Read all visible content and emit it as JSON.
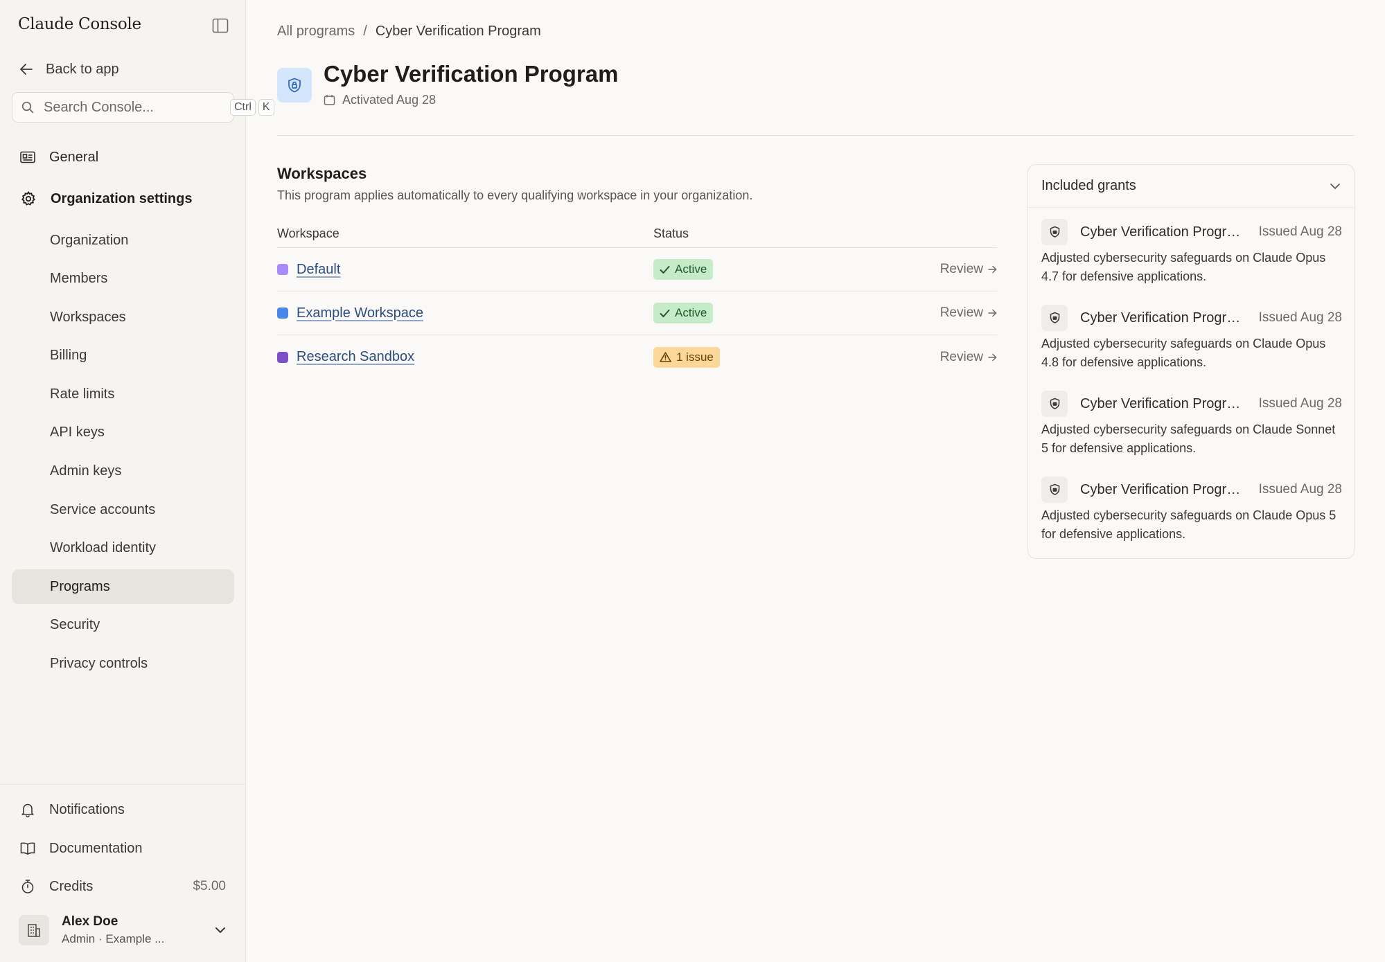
{
  "sidebar": {
    "brand": "Claude Console",
    "back_label": "Back to app",
    "search_placeholder": "Search Console...",
    "search_kbd_ctrl": "Ctrl",
    "search_kbd_key": "K",
    "general_label": "General",
    "org_settings_label": "Organization settings",
    "items": [
      {
        "label": "Organization"
      },
      {
        "label": "Members"
      },
      {
        "label": "Workspaces"
      },
      {
        "label": "Billing"
      },
      {
        "label": "Rate limits"
      },
      {
        "label": "API keys"
      },
      {
        "label": "Admin keys"
      },
      {
        "label": "Service accounts"
      },
      {
        "label": "Workload identity"
      },
      {
        "label": "Programs",
        "active": true
      },
      {
        "label": "Security"
      },
      {
        "label": "Privacy controls"
      }
    ],
    "notifications_label": "Notifications",
    "documentation_label": "Documentation",
    "credits_label": "Credits",
    "credits_amount": "$5.00",
    "user": {
      "name": "Alex Doe",
      "role": "Admin",
      "org": "Example ..."
    }
  },
  "main": {
    "breadcrumb_root": "All programs",
    "breadcrumb_sep": "/",
    "breadcrumb_current": "Cyber Verification Program",
    "title": "Cyber Verification Program",
    "activated": "Activated Aug 28",
    "workspaces": {
      "title": "Workspaces",
      "description": "This program applies automatically to every qualifying workspace in your organization.",
      "col_workspace": "Workspace",
      "col_status": "Status",
      "rows": [
        {
          "name": "Default",
          "color": "#a78bfa",
          "status": "Active",
          "status_type": "active",
          "action": "Review"
        },
        {
          "name": "Example Workspace",
          "color": "#4a86e8",
          "status": "Active",
          "status_type": "active",
          "action": "Review"
        },
        {
          "name": "Research Sandbox",
          "color": "#7e4fc9",
          "status": "1 issue",
          "status_type": "issue",
          "action": "Review"
        }
      ]
    },
    "grants": {
      "title": "Included grants",
      "items": [
        {
          "name": "Cyber Verification Program",
          "date": "Issued Aug 28",
          "description": "Adjusted cybersecurity safeguards on Claude Opus 4.7 for defensive applications."
        },
        {
          "name": "Cyber Verification Program",
          "date": "Issued Aug 28",
          "description": "Adjusted cybersecurity safeguards on Claude Opus 4.8 for defensive applications."
        },
        {
          "name": "Cyber Verification Program",
          "date": "Issued Aug 28",
          "description": "Adjusted cybersecurity safeguards on Claude Sonnet 5 for defensive applications."
        },
        {
          "name": "Cyber Verification Program",
          "date": "Issued Aug 28",
          "description": "Adjusted cybersecurity safeguards on Claude Opus 5 for defensive applications."
        }
      ]
    }
  },
  "colors": {
    "background": "#faf9f7",
    "sidebar": "#f5f4f1",
    "active_nav": "#e6e4df",
    "badge_active": "#c6ebc8",
    "badge_issue": "#fbd899",
    "program_icon_bg": "#d4e6fb",
    "link": "#2a4d80"
  }
}
